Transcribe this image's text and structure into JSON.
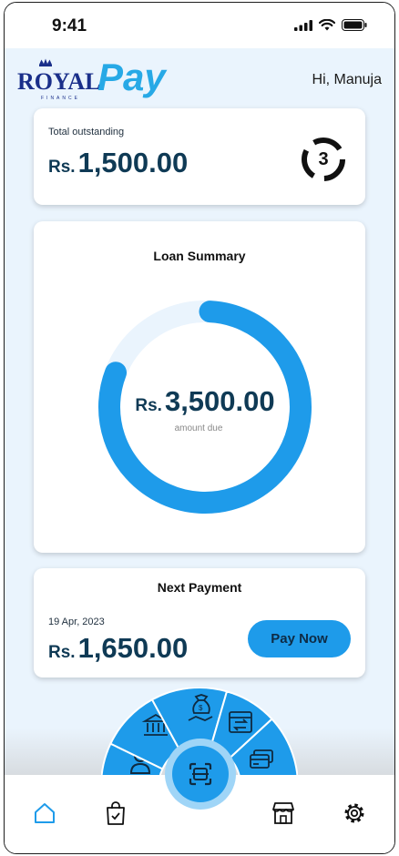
{
  "status_bar": {
    "time": "9:41"
  },
  "brand": {
    "logo_royal": "ROYAL",
    "logo_pay": "Pay",
    "logo_sub": "FINANCE"
  },
  "header": {
    "greeting": "Hi, Manuja"
  },
  "outstanding": {
    "label": "Total outstanding",
    "currency": "Rs.",
    "amount": "1,500.00",
    "badge_count": "3"
  },
  "loan_summary": {
    "title": "Loan Summary",
    "currency": "Rs.",
    "amount": "3,500.00",
    "caption": "amount due",
    "progress_fraction": 0.8
  },
  "next_payment": {
    "title": "Next Payment",
    "date": "19 Apr, 2023",
    "currency": "Rs.",
    "amount": "1,650.00",
    "button_label": "Pay Now"
  },
  "radial_menu": {
    "items": [
      "profile-icon",
      "bank-icon",
      "money-bag-icon",
      "transfer-icon",
      "card-icon"
    ],
    "center": "scan-icon"
  },
  "bottom_nav": {
    "items": [
      "home-icon",
      "shopping-bag-icon",
      "store-icon",
      "settings-icon"
    ]
  },
  "colors": {
    "accent": "#1e9bea",
    "accent_light": "#9fd5f7",
    "navy": "#0f3a55",
    "background": "#eaf4fd"
  }
}
